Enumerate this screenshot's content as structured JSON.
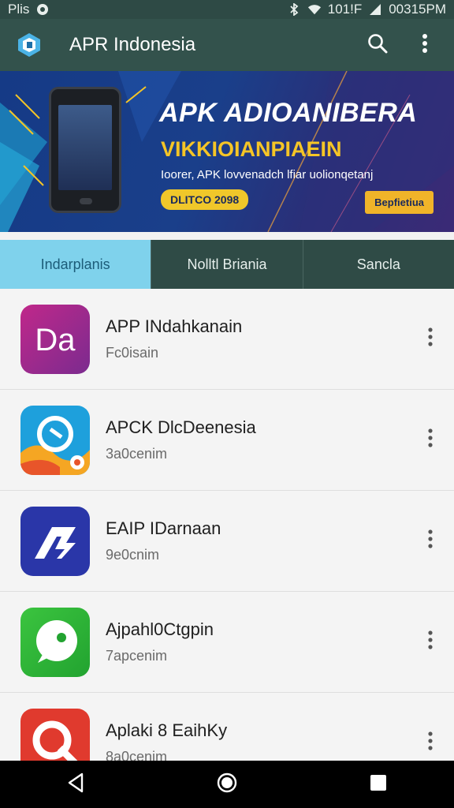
{
  "status_bar": {
    "left_text": "Plis",
    "carrier_text": "101!F",
    "time": "00315PM"
  },
  "app_bar": {
    "title": "APR Indonesia"
  },
  "banner": {
    "title": "APK ADIOANIBERA",
    "subtitle": "VIKKIOIANPIAEIN",
    "text": "Ioorer, APK lovvenadch lfiar uolionqetanj",
    "badge": "DLITCO 2098",
    "cta": "Bepfietiua"
  },
  "tabs": [
    {
      "label": "Indarplanis",
      "active": true
    },
    {
      "label": "Nolltl Briania",
      "active": false
    },
    {
      "label": "Sancla",
      "active": false
    }
  ],
  "apps": [
    {
      "name": "APP INdahkanain",
      "size": "Fc0isain",
      "icon": "da-logo-icon"
    },
    {
      "name": "APCK DlcDeenesia",
      "size": "3a0cenim",
      "icon": "camera-chat-icon"
    },
    {
      "name": "EAIP IDarnaan",
      "size": "9e0cnim",
      "icon": "arrow-logo-icon"
    },
    {
      "name": "Ajpahl0Ctgpin",
      "size": "7apcenim",
      "icon": "chat-bubble-icon"
    },
    {
      "name": "Aplaki 8 EaihKy",
      "size": "8a0cenim",
      "icon": "g-logo-icon"
    }
  ],
  "colors": {
    "status_bar": "#2e4a45",
    "app_bar": "#33524c",
    "tab_active": "#7fd2ec",
    "banner_accent": "#f0c72a"
  }
}
